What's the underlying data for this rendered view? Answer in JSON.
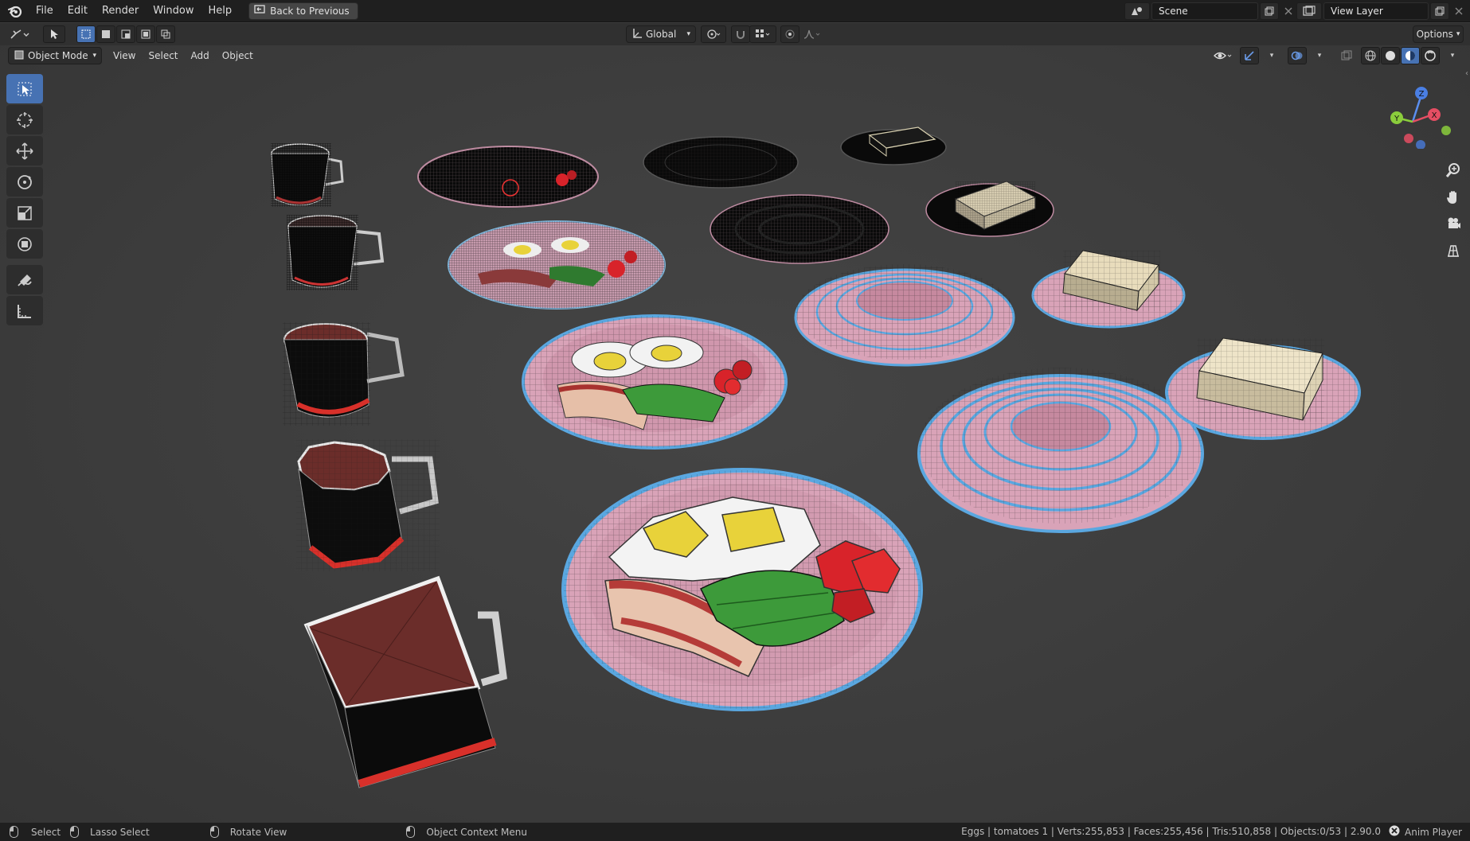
{
  "menubar": {
    "items": [
      "File",
      "Edit",
      "Render",
      "Window",
      "Help"
    ],
    "back_label": "Back to Previous",
    "scene_label": "Scene",
    "view_layer_label": "View Layer"
  },
  "header": {
    "transform_orientation": "Global",
    "options_label": "Options"
  },
  "viewport_header": {
    "mode": "Object Mode",
    "menus": [
      "View",
      "Select",
      "Add",
      "Object"
    ]
  },
  "tools": [
    "select-box",
    "cursor",
    "move",
    "rotate",
    "scale",
    "transform",
    "annotate",
    "measure"
  ],
  "gizmo": {
    "x": "X",
    "y": "Y",
    "z": "Z"
  },
  "statusbar": {
    "select": "Select",
    "lasso": "Lasso Select",
    "rotate": "Rotate View",
    "context": "Object Context Menu",
    "stats": "Eggs | tomatoes 1 | Verts:255,853 | Faces:255,456 | Tris:510,858 | Objects:0/53 | 2.90.0",
    "anim_player": "Anim Player"
  },
  "colors": {
    "accent": "#4772b3",
    "plate_pink": "#d9a3b8",
    "plate_blue": "#5aa7e0",
    "mug_red": "#d8302a",
    "coffee": "#6b2d2a",
    "egg_yolk": "#e8d23a",
    "tomato": "#d8232a",
    "lettuce": "#3d9a3a",
    "toast": "#e8dcbc"
  }
}
